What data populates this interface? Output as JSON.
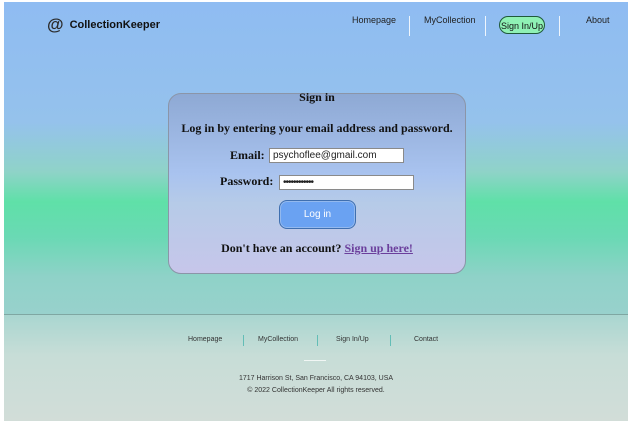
{
  "header": {
    "logo_text": "CollectionKeeper",
    "logo_icon": "at-sign-icon",
    "nav": {
      "homepage": "Homepage",
      "collection": "MyCollection",
      "signin": "Sign In/Up",
      "about": "About"
    }
  },
  "login": {
    "title": "Sign in",
    "subtitle": "Log in by entering your email address and password.",
    "email_label": "Email:",
    "email_value": "psychoflee@gmail.com",
    "password_label": "Password:",
    "password_value": "••••••••••••",
    "button_label": "Log in",
    "no_account_text": "Don't have an account?",
    "signup_link": "Sign up here!"
  },
  "footer": {
    "nav": {
      "homepage": "Homepage",
      "collection": "MyCollection",
      "signin": "Sign In/Up",
      "contact": "Contact"
    },
    "address": "1717 Harrison St, San Francisco, CA 94103, USA",
    "copyright": "© 2022 CollectionKeeper  All rights reserved."
  },
  "colors": {
    "sky": "#8fbcf2",
    "mint": "#5fe0a8",
    "active_pill": "#8ff1b5",
    "button": "#6aa2f2",
    "link": "#6b3f9c"
  }
}
